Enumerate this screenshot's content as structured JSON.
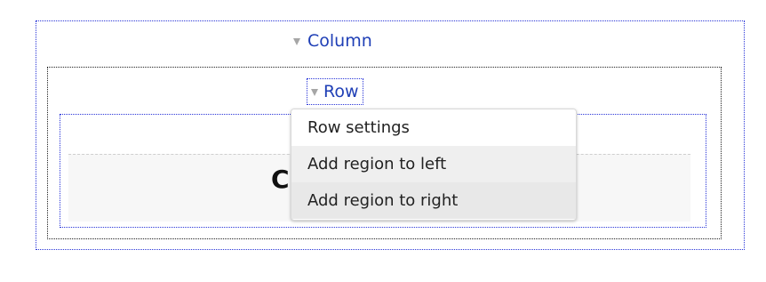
{
  "layout": {
    "column": {
      "label": "Column",
      "toggle_icon": "disclosure-triangle-down-icon"
    },
    "row": {
      "label": "Row",
      "toggle_icon": "disclosure-triangle-down-icon"
    },
    "region": {
      "content_text": "C"
    }
  },
  "context_menu": {
    "items": [
      "Row settings",
      "Add region to left",
      "Add region to right"
    ]
  },
  "colors": {
    "link_blue": "#1f3fb6",
    "column_border": "#2a36d8",
    "row_border": "#222222",
    "menu_border": "#d9d9d9"
  }
}
